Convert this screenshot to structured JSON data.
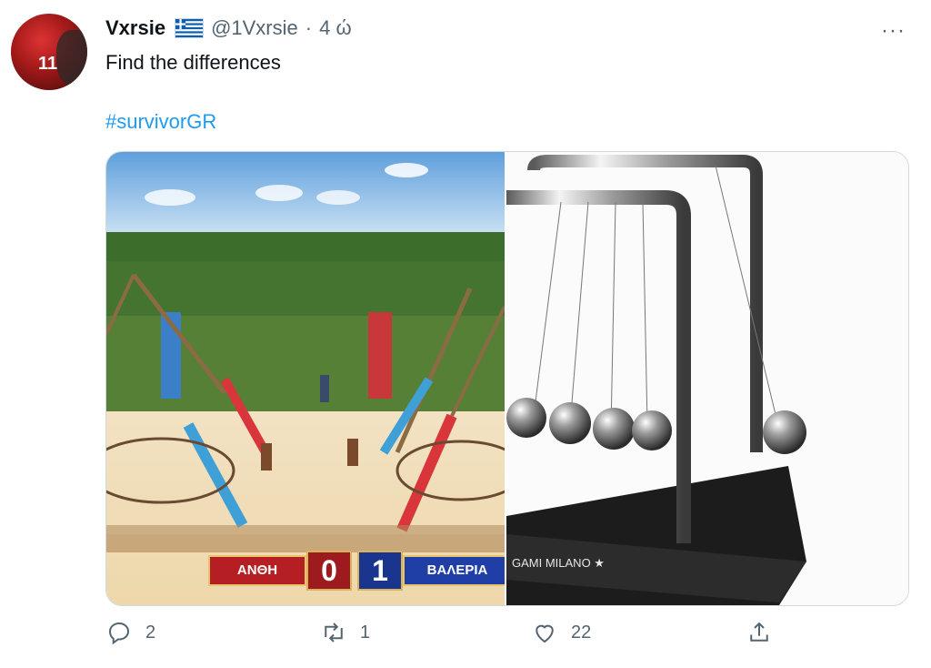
{
  "tweet": {
    "display_name": "Vxrsie",
    "flag": "greek-flag",
    "handle": "@1Vxrsie",
    "separator": "·",
    "time": "4 ώ",
    "text": "Find the differences",
    "hashtag": "#survivorGR",
    "more_label": "···"
  },
  "media": {
    "left": {
      "score": {
        "team_left": "ΑΝΘΗ",
        "score_left": "0",
        "score_right": "1",
        "team_right": "ΒΑΛΕΡΙΑ"
      }
    },
    "right": {
      "brand_text": "GAMI MILANO ★"
    }
  },
  "actions": {
    "reply_count": "2",
    "retweet_count": "1",
    "like_count": "22"
  },
  "colors": {
    "accent": "#1d9bf0",
    "muted": "#536471",
    "text": "#0f1419",
    "border": "#cfd9de"
  }
}
